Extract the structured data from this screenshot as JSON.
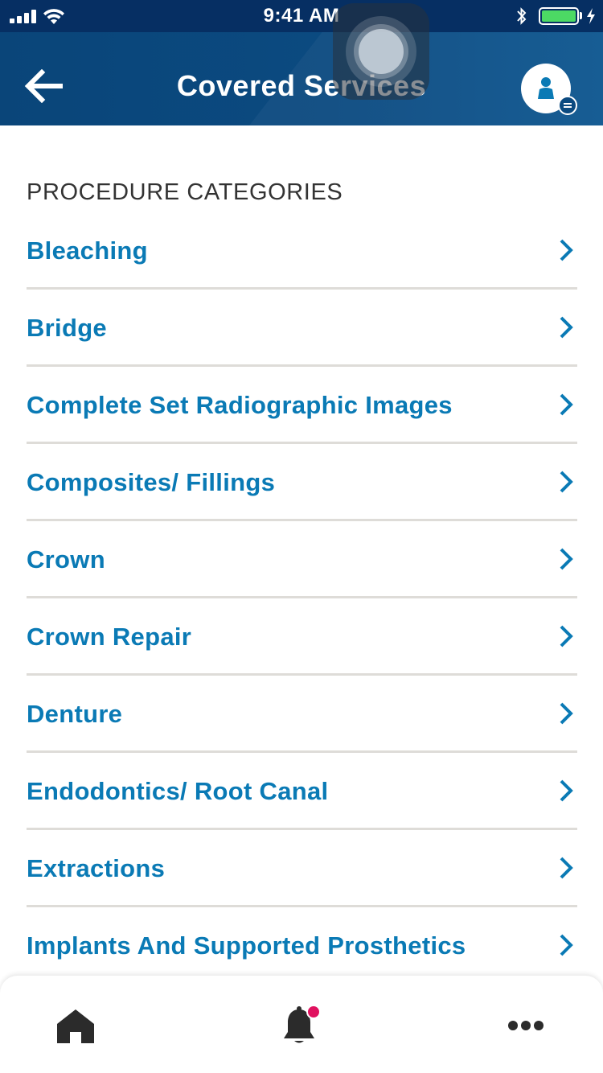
{
  "status_bar": {
    "time": "9:41 AM",
    "battery_color": "#4cd964"
  },
  "header": {
    "title": "Covered Services",
    "back_icon": "arrow-left-icon",
    "profile_icon": "user-icon",
    "background_color": "#0b4a80"
  },
  "section": {
    "label": "PROCEDURE CATEGORIES"
  },
  "categories": [
    {
      "label": "Bleaching"
    },
    {
      "label": "Bridge"
    },
    {
      "label": "Complete Set Radiographic Images"
    },
    {
      "label": "Composites/ Fillings"
    },
    {
      "label": "Crown"
    },
    {
      "label": "Crown Repair"
    },
    {
      "label": "Denture"
    },
    {
      "label": "Endodontics/ Root Canal"
    },
    {
      "label": "Extractions"
    },
    {
      "label": "Implants And Supported Prosthetics"
    }
  ],
  "tab_bar": {
    "tabs": [
      {
        "icon": "home-icon"
      },
      {
        "icon": "bell-icon"
      },
      {
        "icon": "more-icon"
      }
    ],
    "notification_dot_color": "#e0115f"
  },
  "colors": {
    "link": "#0a7ab5",
    "divider": "#dedcd8"
  }
}
